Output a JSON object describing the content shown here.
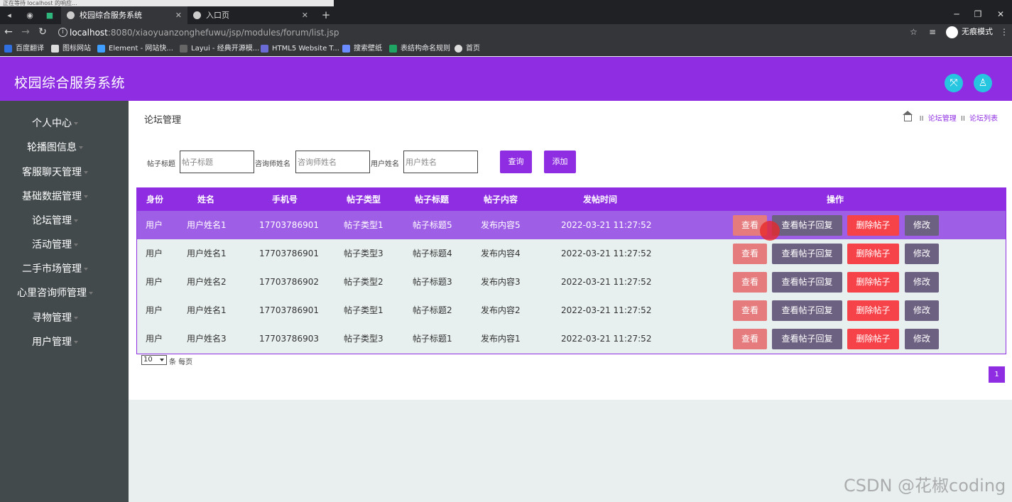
{
  "browser": {
    "status_text": "正在等待 localhost 的响应...",
    "tabs": [
      {
        "label": "校园综合服务系统"
      },
      {
        "label": "入口页"
      }
    ],
    "new_tab": "+",
    "url_host": "localhost",
    "url_path": ":8080/xiaoyuanzonghefuwu/jsp/modules/forum/list.jsp",
    "incognito": "无痕模式",
    "bookmarks": [
      "百度翻译",
      "图标网站",
      "Element - 网站快...",
      "Layui - 经典开源模...",
      "HTML5 Website T...",
      "搜索壁纸",
      "表结构命名规则",
      "首页"
    ]
  },
  "app": {
    "title": "校园综合服务系统",
    "accent": "#8e2de2"
  },
  "sidebar": {
    "items": [
      "个人中心",
      "轮播图信息",
      "客服聊天管理",
      "基础数据管理",
      "论坛管理",
      "活动管理",
      "二手市场管理",
      "心里咨询师管理",
      "寻物管理",
      "用户管理"
    ]
  },
  "page": {
    "title": "论坛管理",
    "breadcrumb": [
      "论坛管理",
      "论坛列表"
    ],
    "breadcrumb_sep": "II"
  },
  "search": {
    "post_title_label": "帖子标题",
    "post_title_placeholder": "帖子标题",
    "counselor_label": "咨询师姓名",
    "counselor_placeholder": "咨询师姓名",
    "user_label": "用户姓名",
    "user_placeholder": "用户姓名",
    "query_button": "查询",
    "add_button": "添加"
  },
  "table": {
    "headers": [
      "身份",
      "姓名",
      "手机号",
      "帖子类型",
      "帖子标题",
      "帖子内容",
      "发帖时间",
      "操作"
    ],
    "rows": [
      {
        "role": "用户",
        "name": "用户姓名1",
        "phone": "17703786901",
        "type": "帖子类型1",
        "title": "帖子标题5",
        "content": "发布内容5",
        "time": "2022-03-21 11:27:52"
      },
      {
        "role": "用户",
        "name": "用户姓名1",
        "phone": "17703786901",
        "type": "帖子类型3",
        "title": "帖子标题4",
        "content": "发布内容4",
        "time": "2022-03-21 11:27:52"
      },
      {
        "role": "用户",
        "name": "用户姓名2",
        "phone": "17703786902",
        "type": "帖子类型2",
        "title": "帖子标题3",
        "content": "发布内容3",
        "time": "2022-03-21 11:27:52"
      },
      {
        "role": "用户",
        "name": "用户姓名1",
        "phone": "17703786901",
        "type": "帖子类型1",
        "title": "帖子标题2",
        "content": "发布内容2",
        "time": "2022-03-21 11:27:52"
      },
      {
        "role": "用户",
        "name": "用户姓名3",
        "phone": "17703786903",
        "type": "帖子类型3",
        "title": "帖子标题1",
        "content": "发布内容1",
        "time": "2022-03-21 11:27:52"
      }
    ],
    "actions": {
      "view": "查看",
      "view_reply": "查看帖子回复",
      "delete": "删除帖子",
      "edit": "修改"
    }
  },
  "pager": {
    "page_size": "10",
    "per_page_text": "条 每页",
    "current_page": "1"
  },
  "watermark": "CSDN @花椒coding"
}
